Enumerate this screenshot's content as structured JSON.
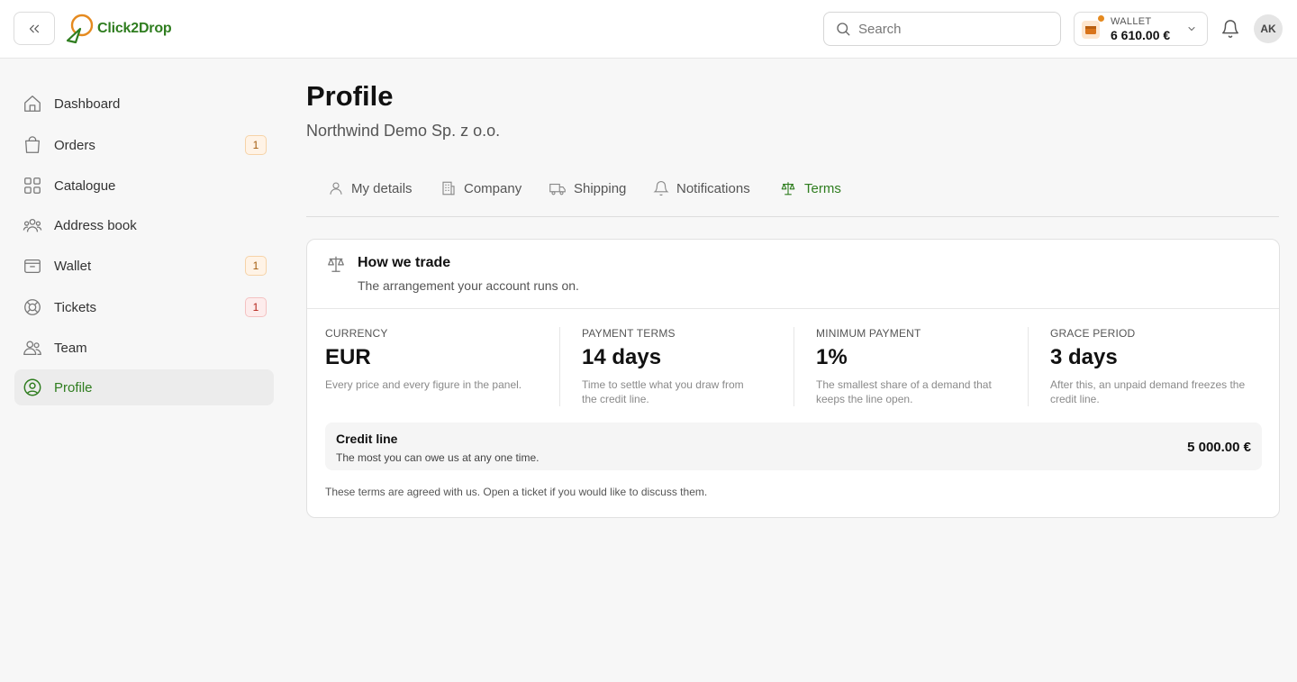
{
  "brand": {
    "name": "Click2Drop",
    "accent": "#2f7d1f",
    "logo_accent": "#e58a1f"
  },
  "header": {
    "search_placeholder": "Search",
    "wallet_label": "WALLET",
    "wallet_amount": "6 610.00 €",
    "avatar_initials": "AK",
    "icons": [
      "chevrons-left-icon",
      "search-icon",
      "wallet-icon",
      "chevron-down-icon",
      "bell-icon"
    ]
  },
  "sidebar": {
    "items": [
      {
        "label": "Dashboard",
        "icon": "home-icon",
        "badge": ""
      },
      {
        "label": "Orders",
        "icon": "bag-icon",
        "badge": "1"
      },
      {
        "label": "Catalogue",
        "icon": "grid-icon",
        "badge": ""
      },
      {
        "label": "Address book",
        "icon": "users-group-icon",
        "badge": ""
      },
      {
        "label": "Wallet",
        "icon": "wallet-icon",
        "badge": "1"
      },
      {
        "label": "Tickets",
        "icon": "lifebuoy-icon",
        "badge": "1"
      },
      {
        "label": "Team",
        "icon": "team-icon",
        "badge": ""
      },
      {
        "label": "Profile",
        "icon": "user-circle-icon",
        "badge": "",
        "active": true
      }
    ]
  },
  "main": {
    "title": "Profile",
    "subtitle": "Northwind Demo Sp. z o.o.",
    "tabs": [
      {
        "label": "My details",
        "icon": "user-icon"
      },
      {
        "label": "Company",
        "icon": "building-icon"
      },
      {
        "label": "Shipping",
        "icon": "truck-icon"
      },
      {
        "label": "Notifications",
        "icon": "bell-icon"
      },
      {
        "label": "Terms",
        "icon": "scale-icon",
        "active": true
      }
    ],
    "card": {
      "title": "How we trade",
      "description": "The arrangement your account runs on.",
      "stats": [
        {
          "label": "CURRENCY",
          "value": "EUR",
          "help": "Every price and every figure in the panel."
        },
        {
          "label": "PAYMENT TERMS",
          "value": "14 days",
          "help_line1": "Time to settle what you draw from",
          "help_line2": "the credit line."
        },
        {
          "label": "MINIMUM PAYMENT",
          "value": "1%",
          "help_line1": "The smallest share of a demand that",
          "help_line2": "keeps the line open."
        },
        {
          "label": "GRACE PERIOD",
          "value": "3 days",
          "help_line1": "After this, an unpaid demand freezes the",
          "help_line2": "credit line."
        }
      ],
      "credit_line": {
        "title": "Credit line",
        "description": "The most you can owe us at any one time.",
        "amount": "5 000.00 €"
      },
      "note": "These terms are agreed with us. Open a ticket if you would like to discuss them."
    }
  }
}
